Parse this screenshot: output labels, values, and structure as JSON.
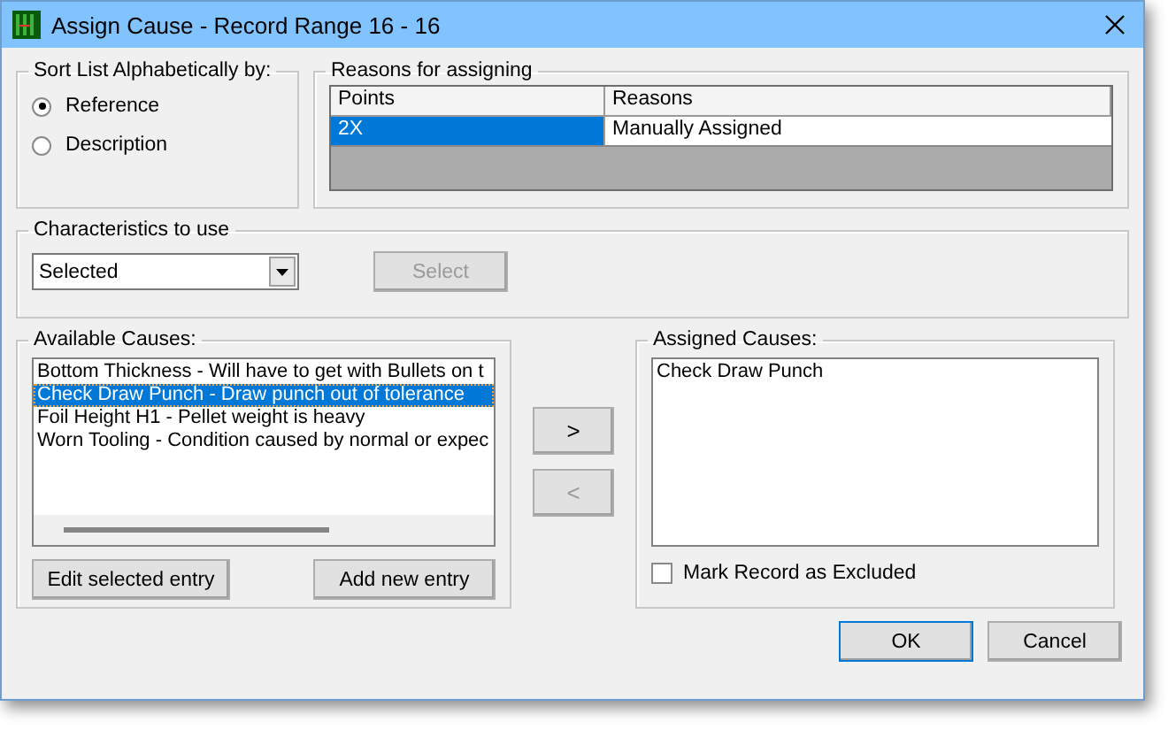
{
  "window": {
    "title": "Assign Cause - Record Range 16 - 16"
  },
  "sort_by": {
    "label": "Sort List Alphabetically by:",
    "options": [
      {
        "label": "Reference",
        "selected": true
      },
      {
        "label": "Description",
        "selected": false
      }
    ]
  },
  "reasons": {
    "label": "Reasons for assigning",
    "columns": [
      "Points",
      "Reasons"
    ],
    "rows": [
      {
        "cells": [
          "2X",
          "Manually Assigned"
        ],
        "selected": true
      }
    ]
  },
  "characteristics": {
    "label": "Characteristics to use",
    "dropdown_value": "Selected",
    "select_button": {
      "label": "Select",
      "disabled": true
    }
  },
  "available": {
    "label": "Available Causes:",
    "items": [
      {
        "text": "Bottom Thickness - Will have to get with Bullets on t",
        "selected": false
      },
      {
        "text": "Check Draw Punch - Draw punch out of tolerance",
        "selected": true
      },
      {
        "text": "Foil Height H1 - Pellet weight is heavy",
        "selected": false
      },
      {
        "text": "Worn Tooling - Condition caused by normal or expec",
        "selected": false
      }
    ],
    "buttons": [
      "Edit selected entry",
      "Add new entry"
    ]
  },
  "transfer_buttons": [
    {
      "label": ">",
      "disabled": false
    },
    {
      "label": "<",
      "disabled": true
    }
  ],
  "assigned": {
    "label": "Assigned Causes:",
    "items": [
      "Check Draw Punch"
    ],
    "exclude": {
      "label": "Mark Record as Excluded",
      "checked": false
    }
  },
  "buttons": [
    "OK",
    "Cancel"
  ]
}
